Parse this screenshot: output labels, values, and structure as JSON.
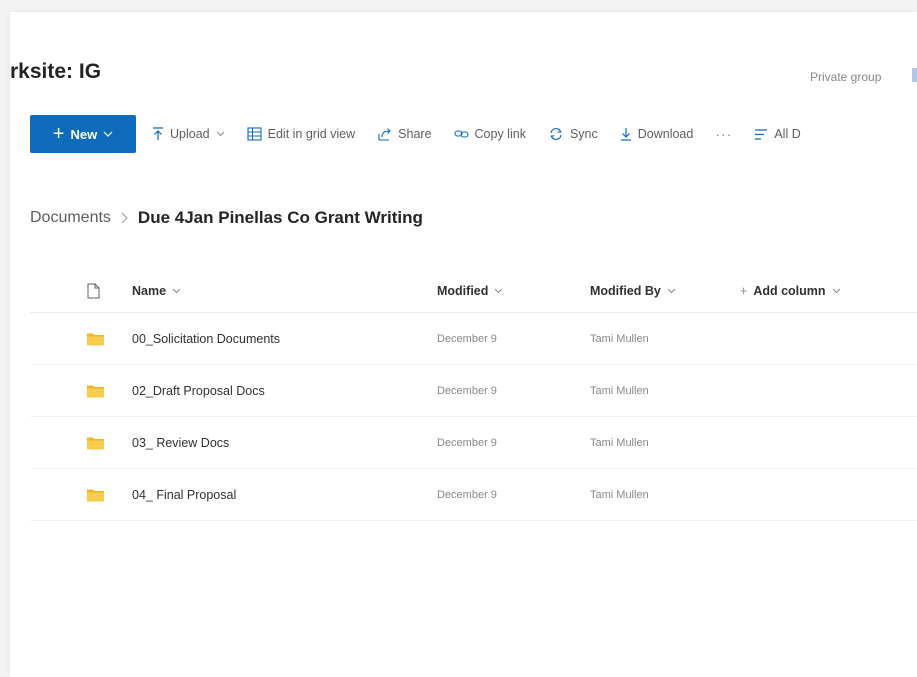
{
  "header": {
    "site_title": "rksite: IG",
    "group_label": "Private group"
  },
  "toolbar": {
    "new_label": "New",
    "upload_label": "Upload",
    "grid_view_label": "Edit in grid view",
    "share_label": "Share",
    "copy_link_label": "Copy link",
    "sync_label": "Sync",
    "download_label": "Download",
    "more_label": "···",
    "all_docs_label": "All D"
  },
  "breadcrumb": {
    "root": "Documents",
    "current": "Due 4Jan Pinellas Co Grant Writing"
  },
  "table": {
    "columns": {
      "name": "Name",
      "modified": "Modified",
      "modified_by": "Modified By",
      "add_column": "Add column"
    },
    "rows": [
      {
        "name": "00_Solicitation Documents",
        "modified": "December 9",
        "modified_by": "Tami Mullen"
      },
      {
        "name": "02_Draft Proposal Docs",
        "modified": "December 9",
        "modified_by": "Tami Mullen"
      },
      {
        "name": "03_ Review Docs",
        "modified": "December 9",
        "modified_by": "Tami Mullen"
      },
      {
        "name": "04_ Final Proposal",
        "modified": "December 9",
        "modified_by": "Tami Mullen"
      }
    ]
  },
  "colors": {
    "accent": "#0f6cbd",
    "folder": "#f5c242"
  },
  "icons": {
    "upload": "upload-icon",
    "grid": "grid-view-icon",
    "share": "share-icon",
    "copy_link": "link-icon",
    "sync": "sync-icon",
    "download": "download-icon",
    "all_docs": "view-options-icon",
    "file": "file-type-icon",
    "folder": "folder-icon"
  }
}
